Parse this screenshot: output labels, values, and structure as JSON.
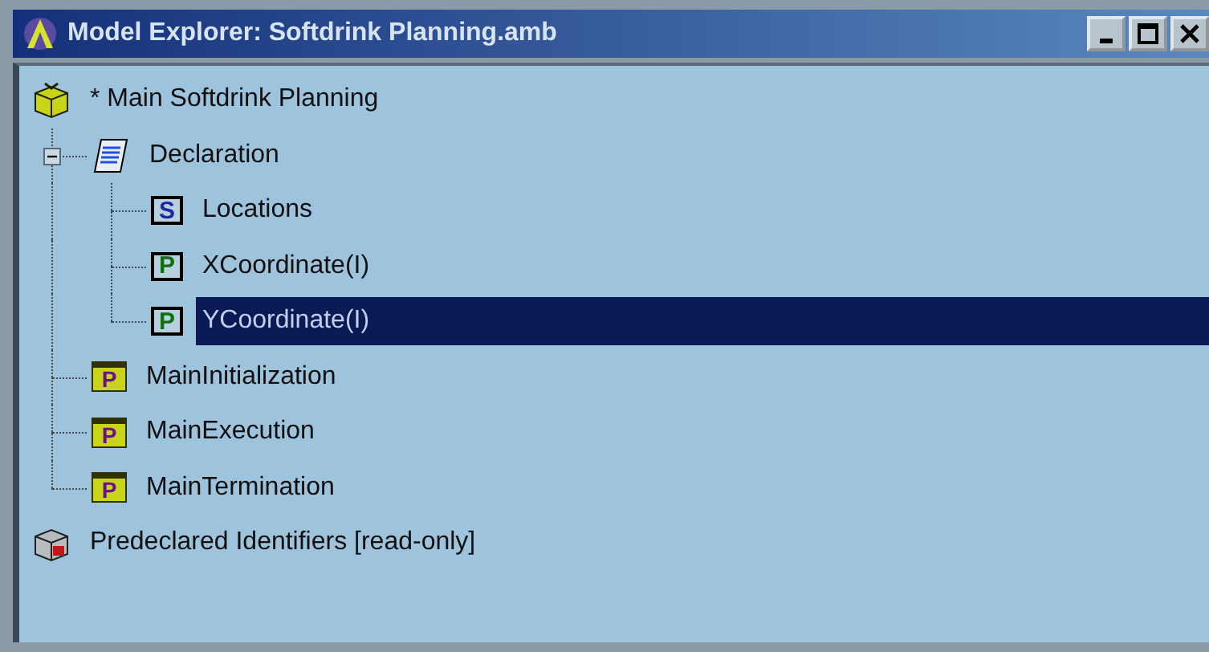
{
  "window": {
    "title": "Model Explorer: Softdrink Planning.amb"
  },
  "tree": [
    {
      "label": "* Main Softdrink Planning",
      "kind": "model",
      "selected": false,
      "children": [
        {
          "label": "Declaration",
          "kind": "declaration",
          "selected": false,
          "expanded": true,
          "children": [
            {
              "label": "Locations",
              "kind": "set",
              "badge": "S",
              "selected": false
            },
            {
              "label": "XCoordinate(I)",
              "kind": "parameter",
              "badge": "P",
              "selected": false
            },
            {
              "label": "YCoordinate(I)",
              "kind": "parameter",
              "badge": "P",
              "selected": true
            }
          ]
        },
        {
          "label": "MainInitialization",
          "kind": "procedure",
          "badge": "P",
          "selected": false
        },
        {
          "label": "MainExecution",
          "kind": "procedure",
          "badge": "P",
          "selected": false
        },
        {
          "label": "MainTermination",
          "kind": "procedure",
          "badge": "P",
          "selected": false
        }
      ]
    },
    {
      "label": "Predeclared Identifiers [read-only]",
      "kind": "library",
      "selected": false
    }
  ]
}
